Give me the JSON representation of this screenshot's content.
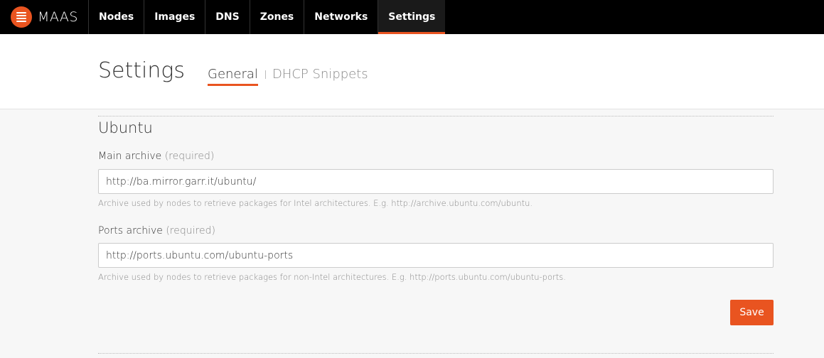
{
  "nav": {
    "brand": "MAAS",
    "items": [
      {
        "label": "Nodes"
      },
      {
        "label": "Images"
      },
      {
        "label": "DNS"
      },
      {
        "label": "Zones"
      },
      {
        "label": "Networks"
      },
      {
        "label": "Settings",
        "active": true
      }
    ]
  },
  "header": {
    "title": "Settings",
    "tabs": [
      {
        "label": "General",
        "active": true
      },
      {
        "label": "DHCP Snippets"
      }
    ]
  },
  "ubuntu": {
    "title": "Ubuntu",
    "main_archive": {
      "label": "Main archive",
      "required": "(required)",
      "value": "http://ba.mirror.garr.it/ubuntu/",
      "help": "Archive used by nodes to retrieve packages for Intel architectures. E.g. http://archive.ubuntu.com/ubuntu."
    },
    "ports_archive": {
      "label": "Ports archive",
      "required": "(required)",
      "value": "http://ports.ubuntu.com/ubuntu-ports",
      "help": "Archive used by nodes to retrieve packages for non-Intel architectures. E.g. http://ports.ubuntu.com/ubuntu-ports."
    },
    "save_label": "Save"
  },
  "colors": {
    "accent": "#e95420",
    "nav_bg": "#000000"
  },
  "icons": {
    "brand": "maas-logo-icon"
  }
}
